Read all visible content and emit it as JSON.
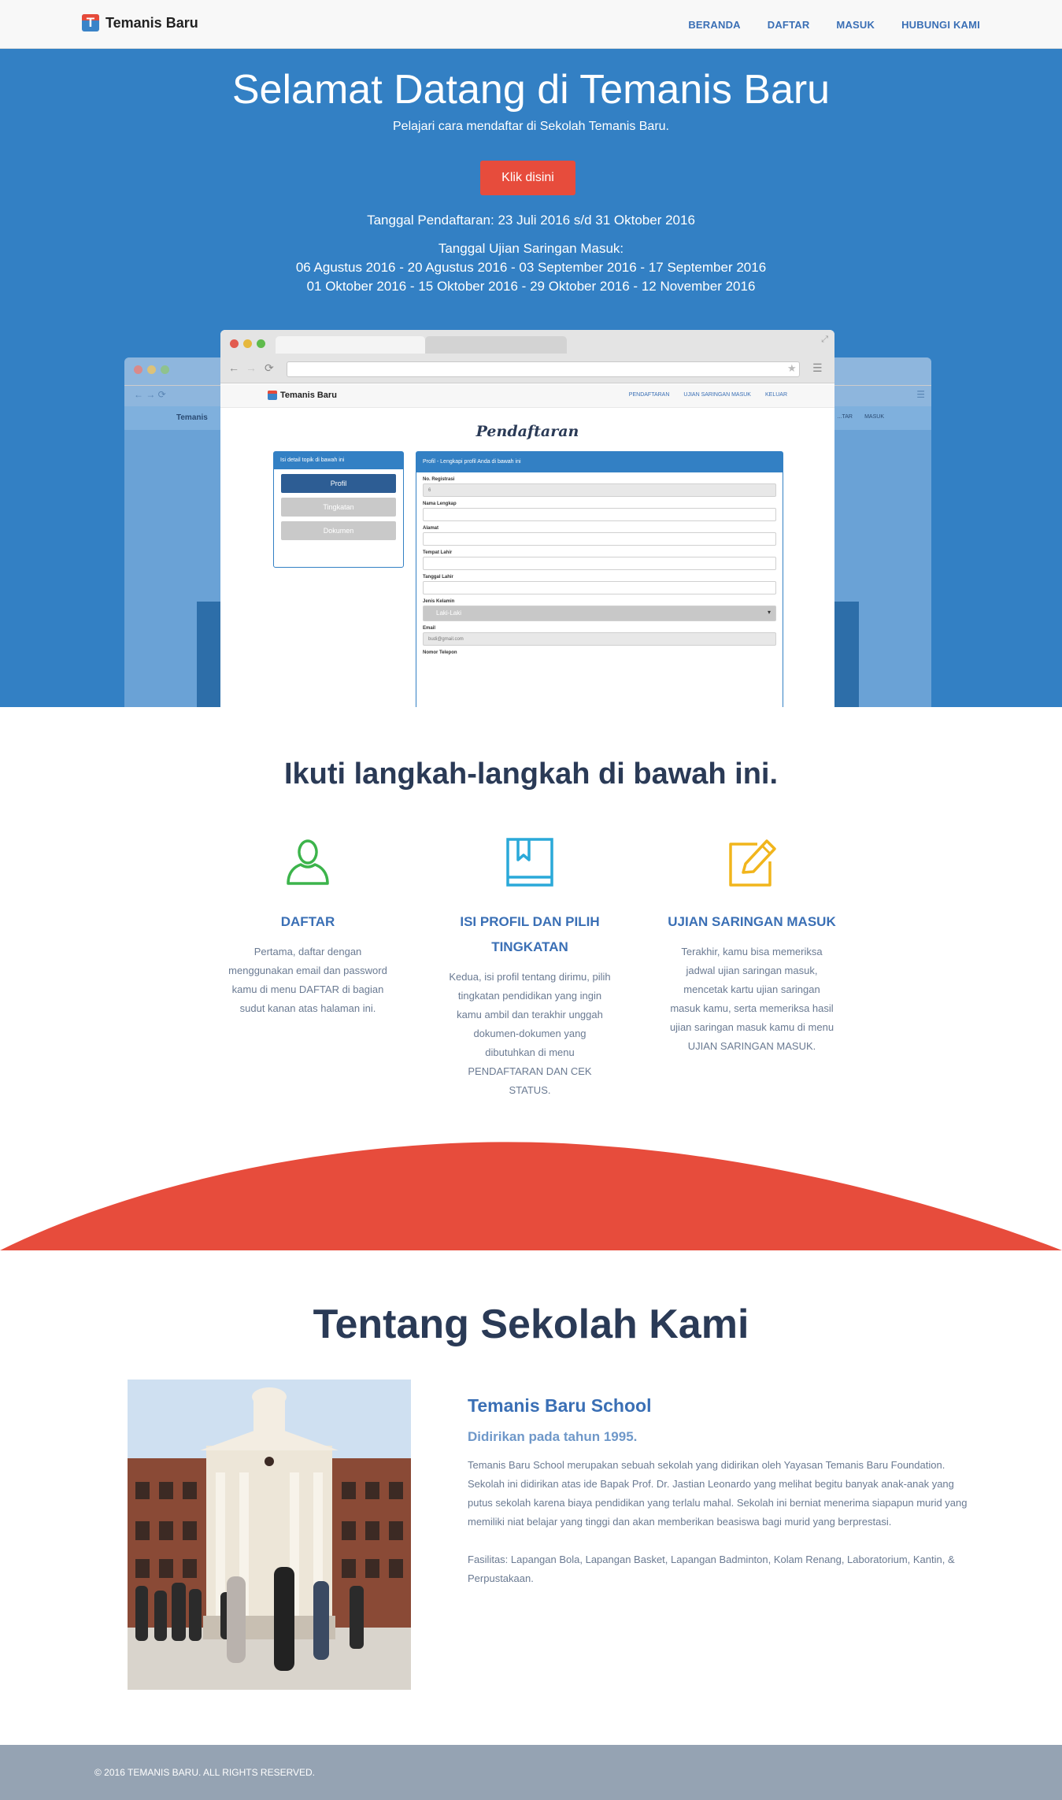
{
  "nav": {
    "brand": "Temanis Baru",
    "brand_letter": "T",
    "links": [
      "BERANDA",
      "DAFTAR",
      "MASUK",
      "HUBUNGI KAMI"
    ]
  },
  "hero": {
    "title": "Selamat Datang di Temanis Baru",
    "subtitle": "Pelajari cara mendaftar di Sekolah Temanis Baru.",
    "button": "Klik disini",
    "registration": "Tanggal Pendaftaran: 23 Juli 2016 s/d 31 Oktober 2016",
    "exam_label": "Tanggal Ujian Saringan Masuk:",
    "exam_line1": "06 Agustus 2016 - 20 Agustus 2016 - 03 September 2016 - 17 September 2016",
    "exam_line2": "01 Oktober 2016 - 15 Oktober 2016 - 29 Oktober 2016 - 12 November 2016",
    "background_color": "#3380c4"
  },
  "mockup": {
    "app_brand": "Temanis Baru",
    "back_brand": "Temanis",
    "app_nav": [
      "PENDAFTARAN",
      "UJIAN SARINGAN MASUK",
      "KELUAR"
    ],
    "back_nav": [
      "...TAR",
      "MASUK"
    ],
    "page_title": "Pendaftaran",
    "left_panel": {
      "header": "Isi detail topik di bawah ini",
      "items": [
        "Profil",
        "Tingkatan",
        "Dokumen"
      ]
    },
    "right_panel": {
      "header": "Profil - Lengkapi profil Anda di bawah ini",
      "fields": [
        {
          "label": "No. Registrasi",
          "value": "6"
        },
        {
          "label": "Nama Lengkap",
          "value": ""
        },
        {
          "label": "Alamat",
          "value": ""
        },
        {
          "label": "Tempat Lahir",
          "value": ""
        },
        {
          "label": "Tanggal Lahir",
          "value": ""
        },
        {
          "label": "Jenis Kelamin",
          "value": "Laki-Laki"
        },
        {
          "label": "Email",
          "value": "budi@gmail.com"
        },
        {
          "label": "Nomor Telepon",
          "value": ""
        }
      ]
    }
  },
  "steps": {
    "title": "Ikuti langkah-langkah di bawah ini.",
    "items": [
      {
        "icon": "user-icon",
        "color": "#3cb44b",
        "title": "DAFTAR",
        "desc": "Pertama, daftar dengan menggunakan email dan password kamu di menu DAFTAR di bagian sudut kanan atas halaman ini."
      },
      {
        "icon": "book-icon",
        "color": "#2aa9d9",
        "title": "ISI PROFIL DAN PILIH TINGKATAN",
        "desc": "Kedua, isi profil tentang dirimu, pilih tingkatan pendidikan yang ingin kamu ambil dan terakhir unggah dokumen-dokumen yang dibutuhkan di menu PENDAFTARAN DAN CEK STATUS."
      },
      {
        "icon": "edit-icon",
        "color": "#f1b51c",
        "title": "UJIAN SARINGAN MASUK",
        "desc": "Terakhir, kamu bisa memeriksa jadwal ujian saringan masuk, mencetak kartu ujian saringan masuk kamu, serta memeriksa hasil ujian saringan masuk kamu di menu UJIAN SARINGAN MASUK."
      }
    ]
  },
  "about": {
    "title": "Tentang Sekolah Kami",
    "name": "Temanis Baru School",
    "established": "Didirikan pada tahun 1995.",
    "paragraph": "Temanis Baru School merupakan sebuah sekolah yang didirikan oleh Yayasan Temanis Baru Foundation. Sekolah ini didirikan atas ide Bapak Prof. Dr. Jastian Leonardo yang melihat begitu banyak anak-anak yang putus sekolah karena biaya pendidikan yang terlalu mahal. Sekolah ini berniat menerima siapapun murid yang memiliki niat belajar yang tinggi dan akan memberikan beasiswa bagi murid yang berprestasi.",
    "facilities": "Fasilitas: Lapangan Bola, Lapangan Basket, Lapangan Badminton, Kolam Renang, Laboratorium, Kantin, & Perpustakaan."
  },
  "footer": {
    "text": "© 2016 TEMANIS BARU. ALL RIGHTS RESERVED."
  },
  "colors": {
    "accent_red": "#e74c3c",
    "nav_link": "#3a6fb5",
    "footer_bg": "#95a3b3"
  }
}
